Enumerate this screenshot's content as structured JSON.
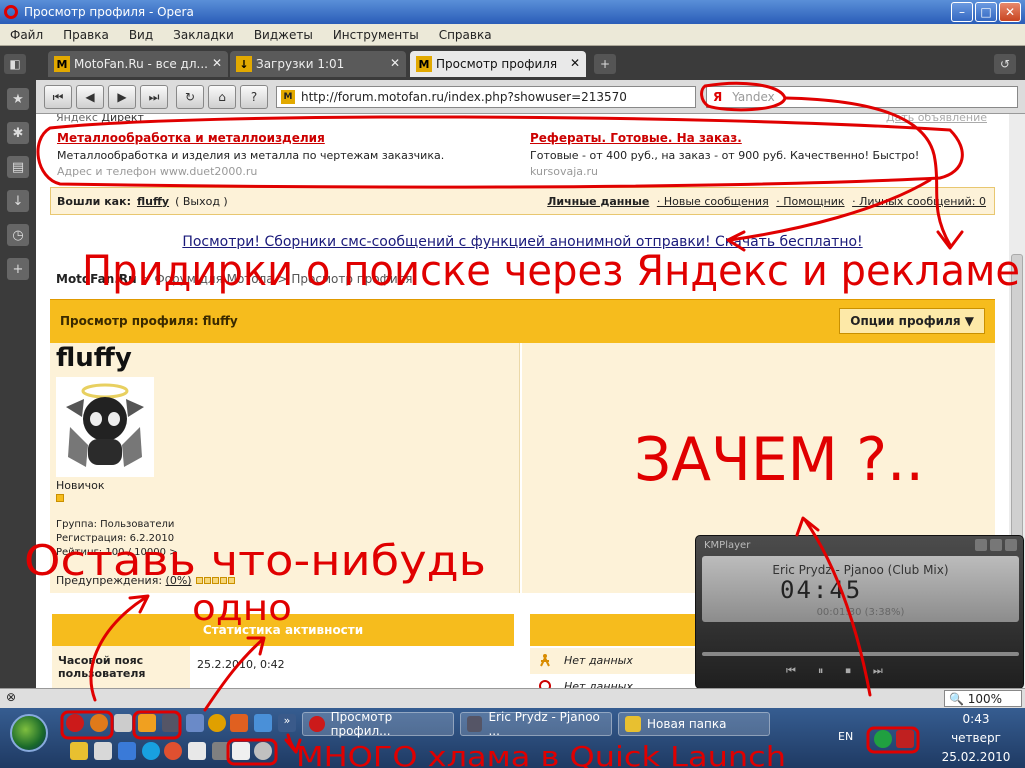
{
  "window": {
    "title": "Просмотр профиля - Opera",
    "controls": {
      "min": "–",
      "max": "□",
      "close": "✕"
    }
  },
  "menu": [
    "Файл",
    "Правка",
    "Вид",
    "Закладки",
    "Виджеты",
    "Инструменты",
    "Справка"
  ],
  "tabs": [
    {
      "label": "MotoFan.Ru - все дл...",
      "icon": "M",
      "active": false
    },
    {
      "label": "Загрузки 1:01",
      "icon": "↓",
      "active": false
    },
    {
      "label": "Просмотр профиля",
      "icon": "M",
      "active": true
    }
  ],
  "address": {
    "url": "http://forum.motofan.ru/index.php?showuser=213570",
    "search_brand": "Я",
    "search_placeholder": "Yandex"
  },
  "ads": {
    "caption_left": "Яндекс",
    "caption_direct": "Директ",
    "caption_right": "Дать объявление",
    "items": [
      {
        "title": "Металлообработка и металлоизделия",
        "desc": "Металлообработка и изделия из металла по чертежам заказчика.",
        "source": "Адрес и телефон    www.duet2000.ru"
      },
      {
        "title": "Рефераты. Готовые. На заказ.",
        "desc": "Готовые - от 400 руб., на заказ - от 900 руб. Качественно! Быстро!",
        "source": "kursovaja.ru"
      }
    ]
  },
  "login": {
    "prefix": "Вошли как:",
    "user": "fluffy",
    "logout": "( Выход )",
    "links": [
      "Личные данные",
      "· Новые сообщения",
      "· Помощник",
      "· Личных сообщений: 0"
    ]
  },
  "promo": "Посмотри! Сборники смс-сообщений с функцией анонимной отправки! Скачать бесплатно!",
  "breadcrumb": {
    "root": "MotoFan.Ru",
    "mid": "> Форум для Мотола",
    "current": "> Просмотр профиля"
  },
  "profile": {
    "header": "Просмотр профиля: fluffy",
    "options_button": "Опции профиля ▼",
    "name": "fluffy",
    "rank": "Новичок",
    "group": "Группа: Пользователи",
    "registered": "Регистрация: 6.2.2010",
    "rating": "Рейтинг: 100 / 10000 >",
    "warnings_label": "Предупреждения:",
    "warnings_value": "(0%)"
  },
  "stats": {
    "header": "Статистика активности",
    "tz_label": "Часовой пояс пользователя",
    "tz_value": "25.2.2010, 0:42",
    "nodata": [
      "Нет данных",
      "Нет данных"
    ]
  },
  "kmplayer": {
    "title": "KMPlayer",
    "track": "Eric Prydz - Pjanoo (Club Mix)",
    "time": "04:45",
    "position": "00:01:30 (3:38%)"
  },
  "statusbar": {
    "zoom": "100%"
  },
  "taskbar": {
    "buttons": [
      "Просмотр профил...",
      "Eric Prydz - Pjanoo ...",
      "Новая папка"
    ],
    "lang": "EN",
    "time": "0:43",
    "day": "четверг",
    "date": "25.02.2010"
  },
  "annotations": {
    "main_complaint": "Придирки о поиске через Яндекс и рекламе",
    "why": "ЗАЧЕМ ?..",
    "leave_one": "Оставь что-нибудь",
    "one": "одно",
    "quick_launch": "МНОГО хлама в Quick Launch"
  },
  "colors": {
    "annotation": "#e00000",
    "forum_accent": "#f6bc1d",
    "forum_bg": "#fdf2d8"
  }
}
